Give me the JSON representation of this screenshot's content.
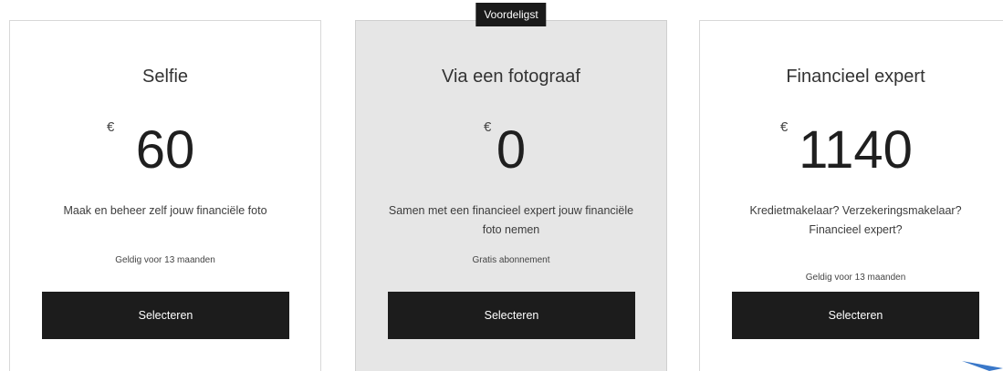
{
  "plans": [
    {
      "title": "Selfie",
      "currency": "€",
      "amount": "60",
      "description": "Maak en beheer zelf jouw financiële foto",
      "validity": "Geldig voor 13 maanden",
      "button_label": "Selecteren"
    },
    {
      "badge": "Voordeligst",
      "title": "Via een fotograaf",
      "currency": "€",
      "amount": "0",
      "description": "Samen met een financieel expert jouw financiële foto nemen",
      "validity": "Gratis abonnement",
      "button_label": "Selecteren"
    },
    {
      "title": "Financieel expert",
      "currency": "€",
      "amount": "1140",
      "description": "Kredietmakelaar? Verzekeringsmakelaar? Financieel expert?",
      "validity": "Geldig voor 13 maanden",
      "button_label": "Selecteren"
    }
  ],
  "colors": {
    "button_bg": "#1c1c1c",
    "featured_bg": "#e6e6e6",
    "badge_bg": "#1a1a1a",
    "arrow": "#3a78c9"
  },
  "icons": {
    "corner": "arrow-icon"
  }
}
